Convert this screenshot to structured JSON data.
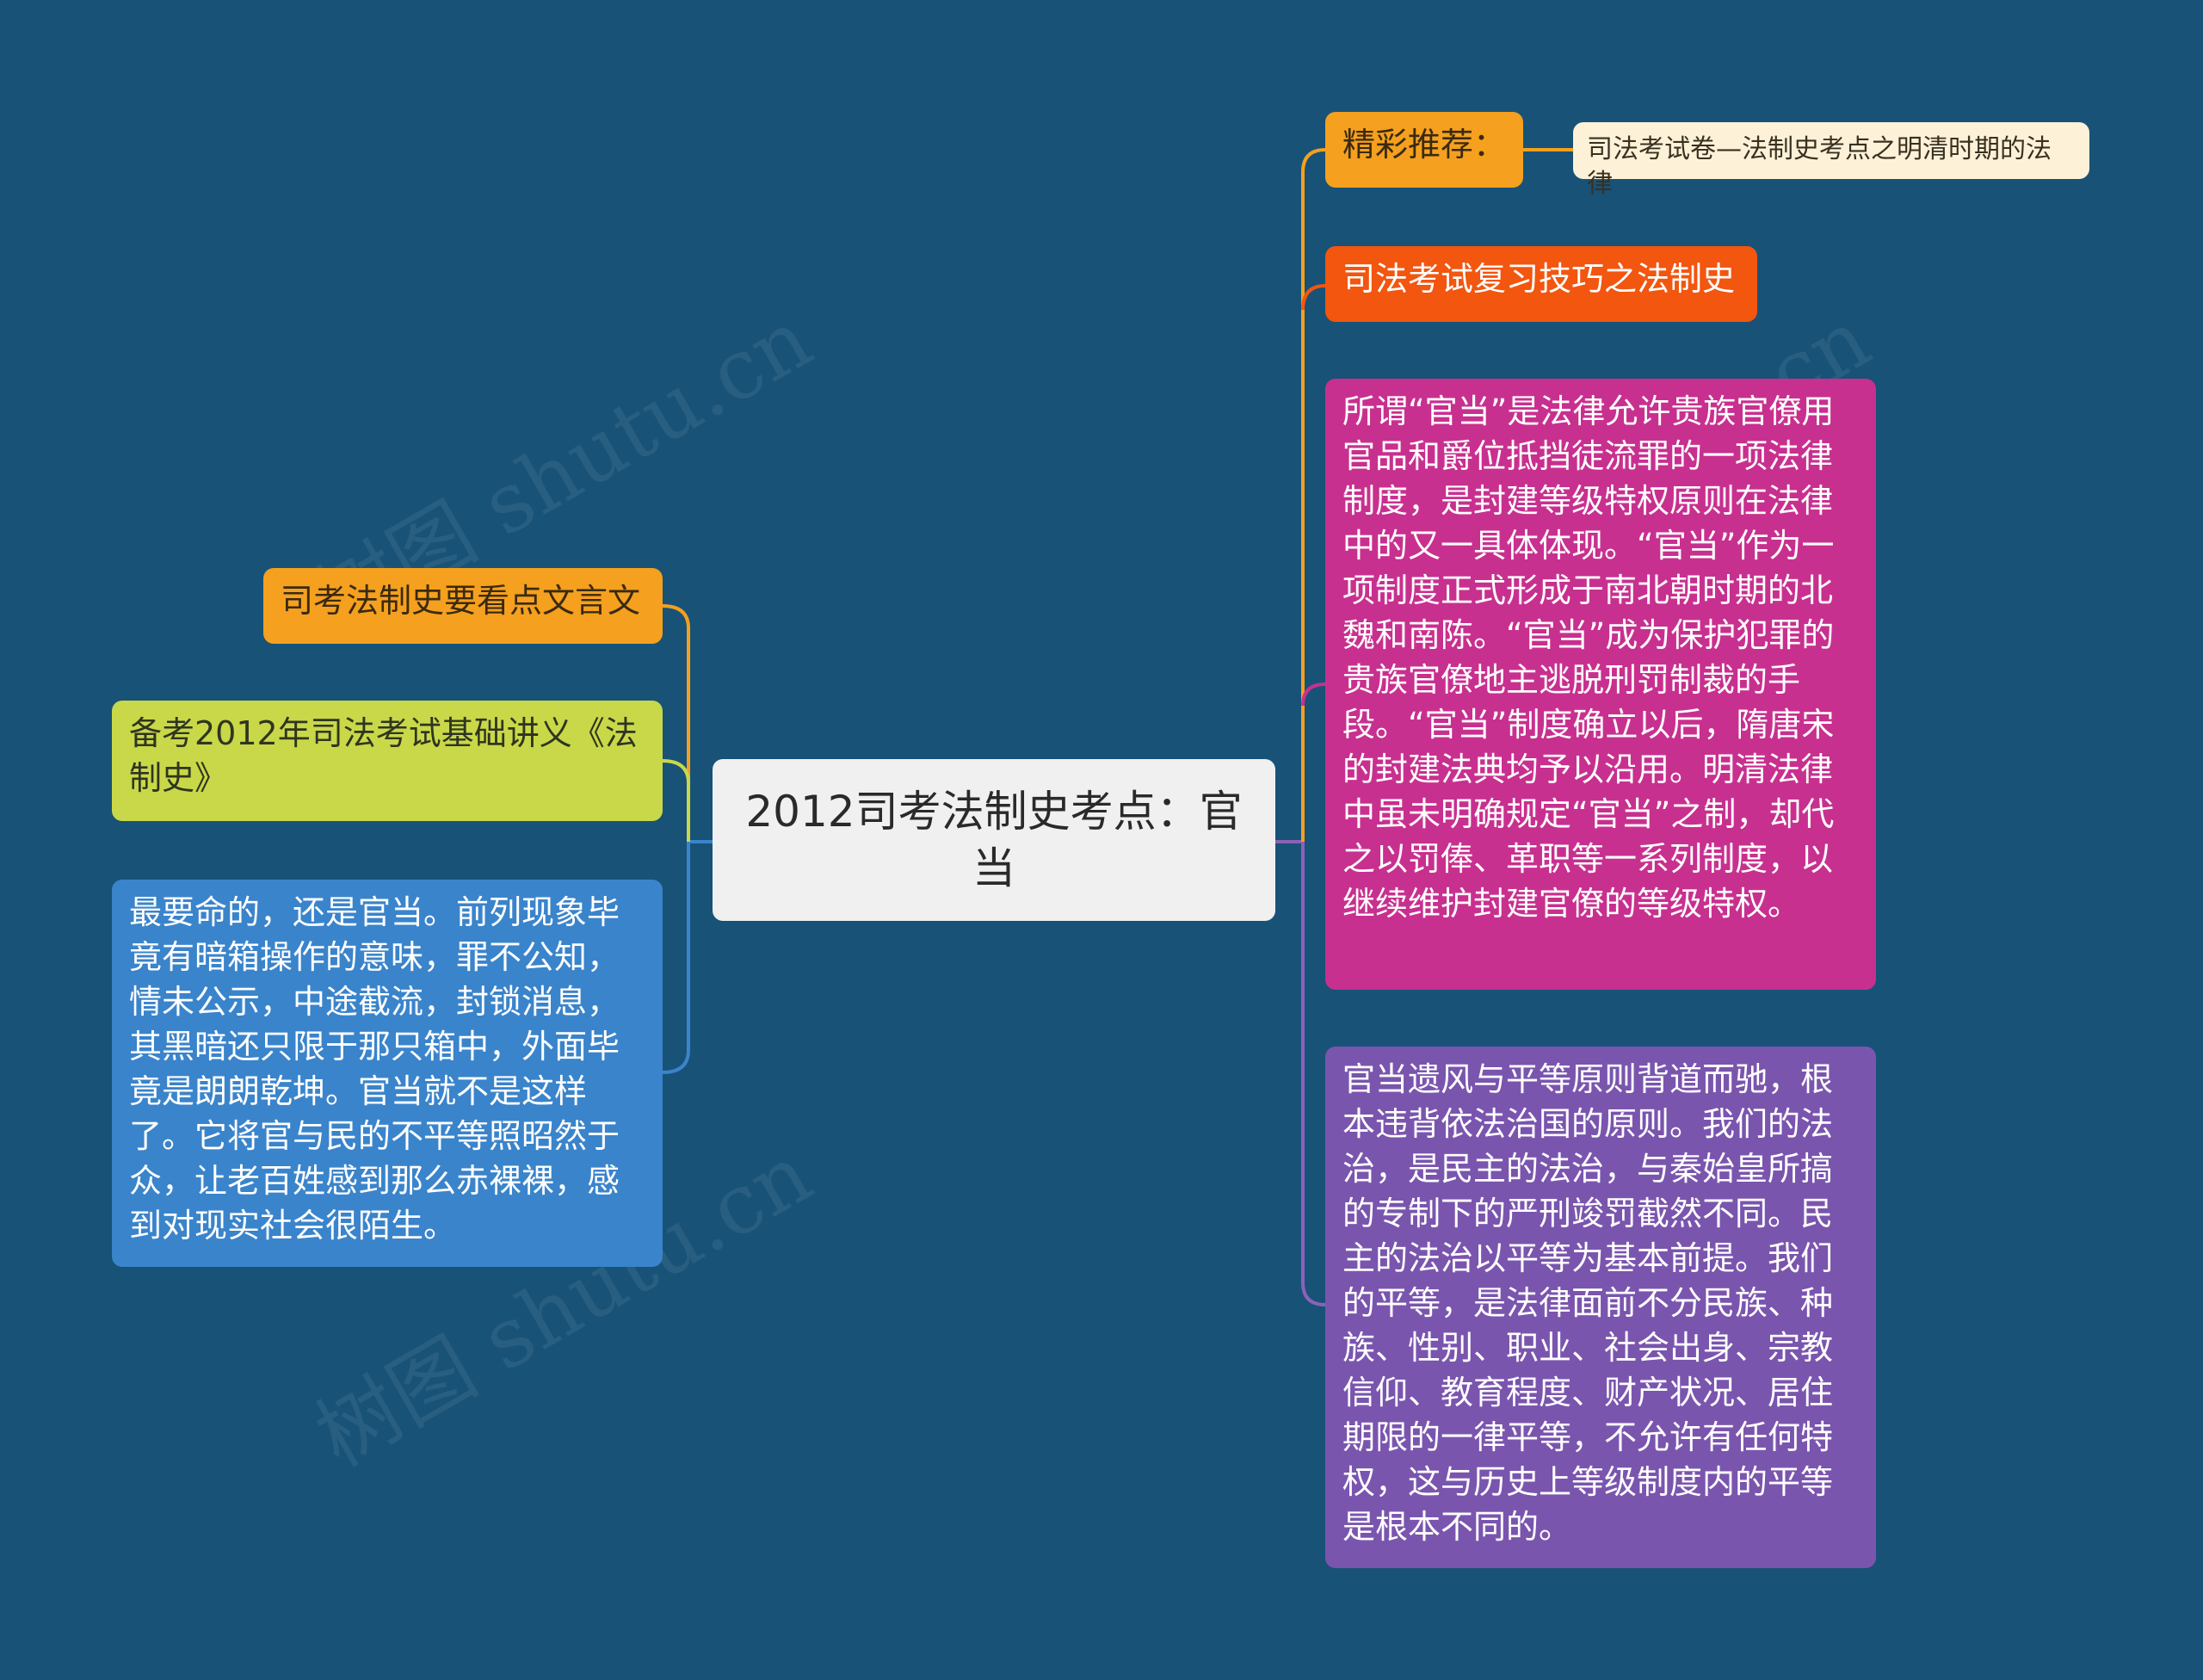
{
  "root": {
    "title": "2012司考法制史考点：官当"
  },
  "right": {
    "recommend_label": "精彩推荐：",
    "recommend_link": "司法考试卷—法制史考点之明清时期的法律",
    "tips": "司法考试复习技巧之法制史",
    "definition": "所谓“官当”是法律允许贵族官僚用官品和爵位抵挡徒流罪的一项法律制度，是封建等级特权原则在法律中的又一具体体现。“官当”作为一项制度正式形成于南北朝时期的北魏和南陈。“官当”成为保护犯罪的贵族官僚地主逃脱刑罚制裁的手段。“官当”制度确立以后，隋唐宋的封建法典均予以沿用。明清法律中虽未明确规定“官当”之制，却代之以罚俸、革职等一系列制度，以继续维护封建官僚的等级特权。",
    "equality": "官当遗风与平等原则背道而驰，根本违背依法治国的原则。我们的法治，是民主的法治，与秦始皇所搞的专制下的严刑竣罚截然不同。民主的法治以平等为基本前提。我们的平等，是法律面前不分民族、种族、性别、职业、社会出身、宗教信仰、教育程度、财产状况、居住期限的一律平等，不允许有任何特权，这与历史上等级制度内的平等是根本不同的。"
  },
  "left": {
    "classical": "司考法制史要看点文言文",
    "lecture": "备考2012年司法考试基础讲义《法制史》",
    "comment": "最要命的，还是官当。前列现象毕竟有暗箱操作的意味，罪不公知，情未公示，中途截流，封锁消息，其黑暗还只限于那只箱中，外面毕竟是朗朗乾坤。官当就不是这样了。它将官与民的不平等照昭然于众，让老百姓感到那么赤裸裸，感到对现实社会很陌生。"
  },
  "watermark": "树图 shutu.cn",
  "colors": {
    "background": "#185277",
    "root": "#f0f0f0",
    "orange": "#f5a01e",
    "red": "#f2560f",
    "magenta": "#c8308f",
    "purple": "#7a55ae",
    "lime": "#c9d848",
    "blue": "#3a84cb",
    "cream": "#fdf2d8"
  }
}
